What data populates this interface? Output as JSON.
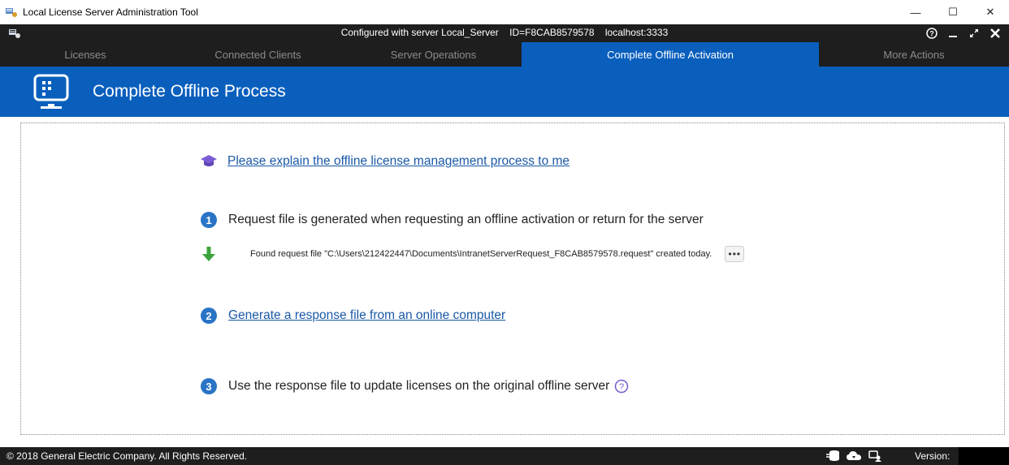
{
  "window": {
    "title": "Local License Server Administration Tool",
    "minimize_glyph": "—",
    "maximize_glyph": "☐",
    "close_glyph": "✕"
  },
  "header": {
    "configured": "Configured with server Local_Server",
    "server_id": "ID=F8CAB8579578",
    "host": "localhost:3333",
    "icons": [
      "help-circle-icon",
      "minimize-icon",
      "expand-icon",
      "close-icon"
    ]
  },
  "tabs": [
    {
      "label": "Licenses",
      "active": false
    },
    {
      "label": "Connected Clients",
      "active": false
    },
    {
      "label": "Server Operations",
      "active": false
    },
    {
      "label": "Complete Offline Activation",
      "active": true
    },
    {
      "label": "More Actions",
      "active": false
    }
  ],
  "page": {
    "title": "Complete Offline Process"
  },
  "content": {
    "explain_link": "Please explain the offline license management process to me",
    "step1": {
      "number": "1",
      "text": "Request file is generated when requesting an offline activation or return for the server",
      "found": "Found request file \"C:\\Users\\212422447\\Documents\\IntranetServerRequest_F8CAB8579578.request\" created today.",
      "more_label": "•••"
    },
    "step2": {
      "number": "2",
      "link": "Generate a response file from an online computer"
    },
    "step3": {
      "number": "3",
      "text": "Use the response file to update licenses on the original offline server"
    }
  },
  "footer": {
    "copyright": "© 2018 General Electric Company. All Rights Reserved.",
    "version_label": "Version:",
    "icons": [
      "database-icon",
      "cloud-sync-icon",
      "users-icon"
    ]
  },
  "colors": {
    "accent_blue": "#0a5fbd",
    "dark_bar": "#1e1e1e",
    "link": "#1a58a6",
    "step_badge": "#2a74c6",
    "arrow_green": "#3ca33c",
    "grad_cap": "#7a5bd4"
  }
}
